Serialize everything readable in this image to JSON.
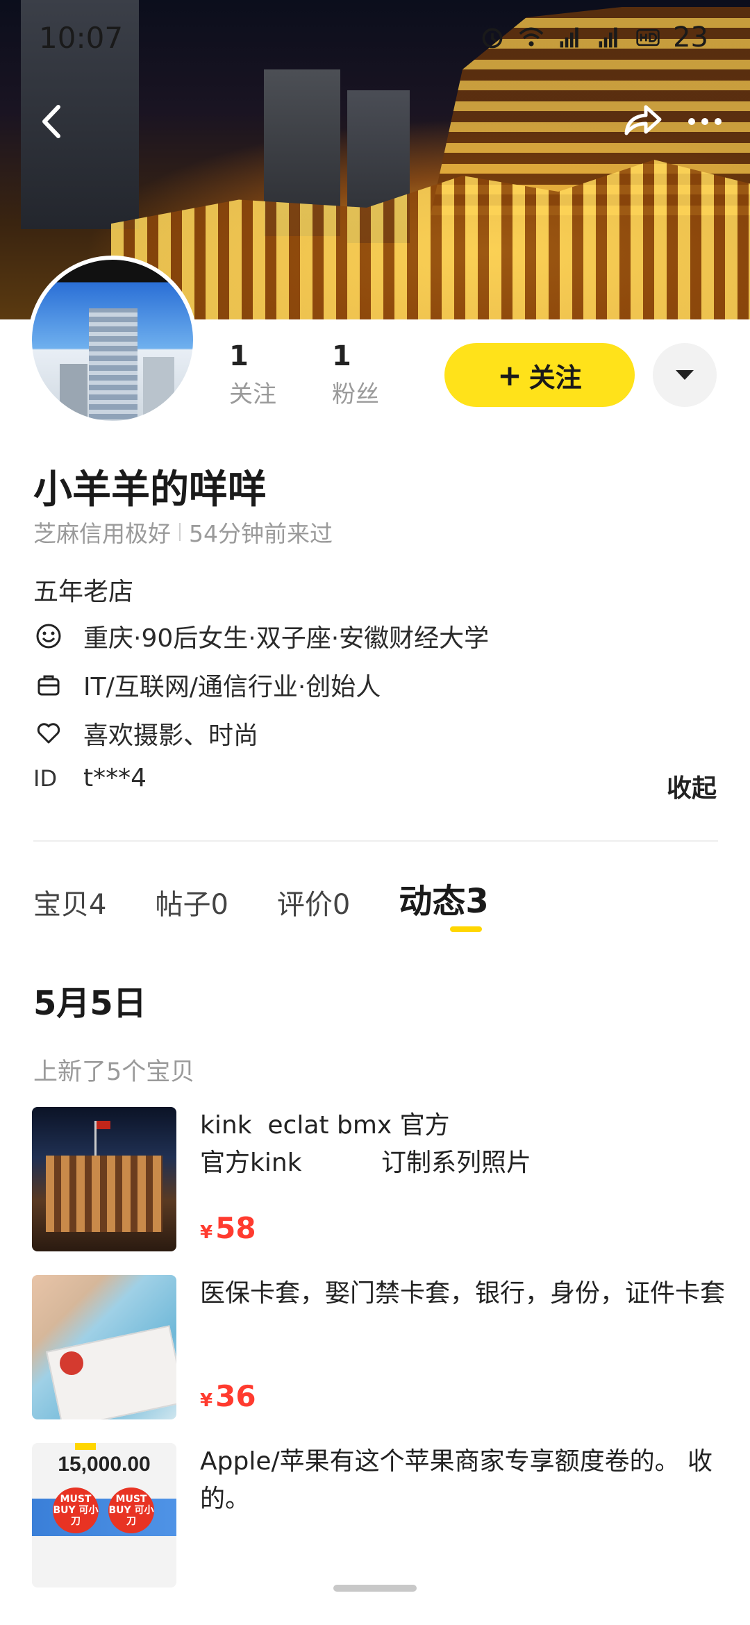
{
  "status_bar": {
    "time": "10:07",
    "battery": "23",
    "icons": [
      "alarm-icon",
      "wifi-icon",
      "signal-4g-icon",
      "signal-4g-icon",
      "hd-icon"
    ]
  },
  "nav": {
    "back_icon": "chevron-left-icon",
    "share_icon": "share-icon",
    "more_icon": "more-dots-icon"
  },
  "profile": {
    "stats": [
      {
        "value": "1",
        "label": "关注"
      },
      {
        "value": "1",
        "label": "粉丝"
      }
    ],
    "follow_button": "关注",
    "follow_plus": "+",
    "dropdown_icon": "caret-down-icon",
    "username": "小羊羊的咩咩",
    "credit": "芝麻信用极好",
    "last_seen": "54分钟前来过",
    "shop_years": "五年老店",
    "info": [
      {
        "icon": "smiley-icon",
        "text": "重庆·90后女生·双子座·安徽财经大学"
      },
      {
        "icon": "briefcase-icon",
        "text": "IT/互联网/通信行业·创始人"
      },
      {
        "icon": "heart-icon",
        "text": "喜欢摄影、时尚"
      }
    ],
    "id_label": "ID",
    "id_value": "t***4",
    "collapse": "收起"
  },
  "tabs": [
    {
      "label": "宝贝",
      "count": "4"
    },
    {
      "label": "帖子",
      "count": "0"
    },
    {
      "label": "评价",
      "count": "0"
    },
    {
      "label": "动态",
      "count": "3",
      "active": true
    }
  ],
  "feed": {
    "date": "5月5日",
    "subtitle": "上新了5个宝贝",
    "items": [
      {
        "title": "kink  eclat bmx 官方\n官方kink          订制系列照片",
        "currency": "¥",
        "price": "58"
      },
      {
        "title": "医保卡套，娶门禁卡套，银行，身份，证件卡套",
        "currency": "¥",
        "price": "36"
      },
      {
        "title": "Apple/苹果有这个苹果商家专享额度卷的。 收的。",
        "thumb_amount": "15,000.00",
        "thumb_badge": "MUST BUY 可小刀"
      }
    ]
  },
  "colors": {
    "accent_yellow": "#ffe21a",
    "price_red": "#ff3b2f",
    "muted": "#9a9a9a"
  }
}
